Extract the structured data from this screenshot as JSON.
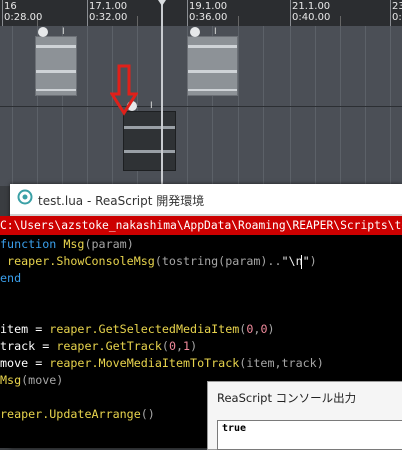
{
  "timeline": {
    "markers": [
      {
        "bar": "16",
        "time": "0:28.00"
      },
      {
        "bar": "17.1.00",
        "time": "0:32.00"
      },
      {
        "bar": "19.1.00",
        "time": "0:36.00"
      },
      {
        "bar": "21.1.00",
        "time": "0:40.00"
      },
      {
        "bar": "23",
        "time": "0:44"
      }
    ]
  },
  "arrange": {
    "item_glyph": "I"
  },
  "editor": {
    "title": "test.lua - ReaScript 開発環境",
    "path": "C:\\Users\\azstoke_nakashima\\AppData\\Roaming\\REAPER\\Scripts\\test.lua",
    "code_lines": [
      {
        "kw": "function",
        "name": "Msg",
        "rest": "(param)"
      },
      {
        "indent": " ",
        "obj": "reaper",
        "fn": ".ShowConsoleMsg",
        "a": "(tostring(param)..",
        "str": "\"\\n\"",
        "b": ")"
      },
      {
        "kw": "end"
      },
      {},
      {},
      {
        "lhs": "item",
        "eq": " = ",
        "obj": "reaper",
        "fn": ".GetSelectedMediaItem",
        "p1": "(",
        "n1": "0",
        "c": ",",
        "n2": "0",
        "p2": ")"
      },
      {
        "lhs": "track",
        "eq": " = ",
        "obj": "reaper",
        "fn": ".GetTrack",
        "p1": "(",
        "n1": "0",
        "c": ",",
        "n2": "1",
        "p2": ")"
      },
      {
        "lhs": "move",
        "eq": " = ",
        "obj": "reaper",
        "fn": ".MoveMediaItemToTrack",
        "args": "(item,track)"
      },
      {
        "call": "Msg",
        "args": "(move)"
      },
      {},
      {
        "obj": "reaper",
        "fn": ".UpdateArrange",
        "args": "()"
      }
    ]
  },
  "console": {
    "title": "ReaScript コンソール出力",
    "output": "true"
  },
  "colors": {
    "arrow": "#e0201a",
    "path_bar": "#cc0000",
    "keyword": "#3a9eea",
    "function": "#e8d44d",
    "number": "#f08a9c"
  }
}
